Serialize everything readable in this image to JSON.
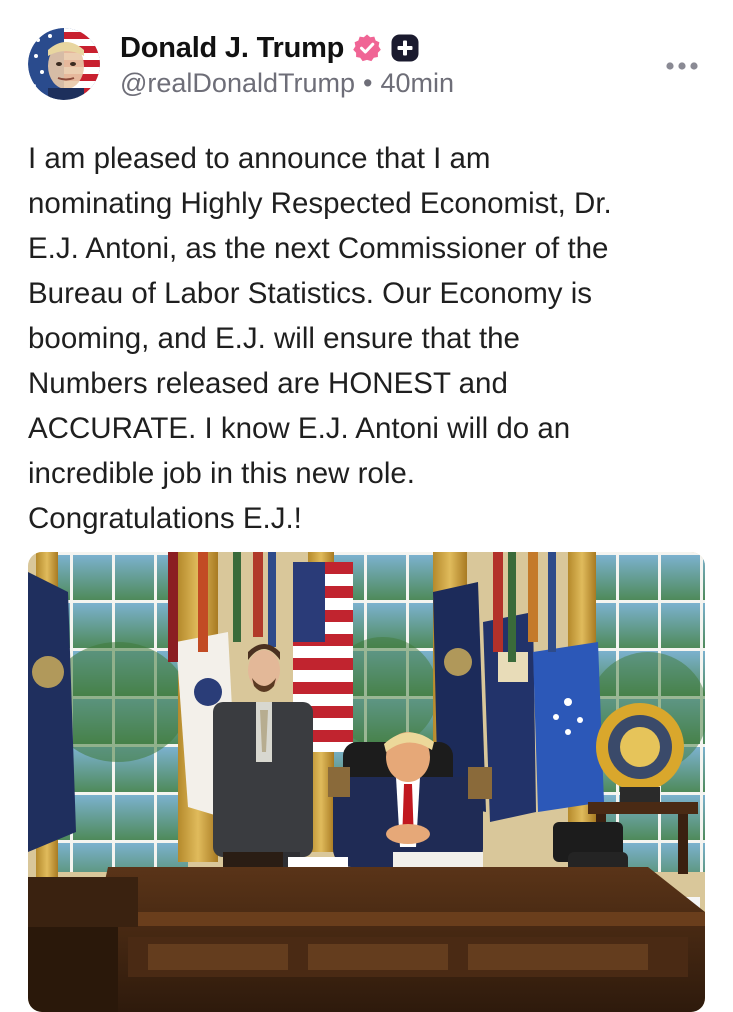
{
  "post": {
    "author": {
      "display_name": "Donald J. Trump",
      "handle": "@realDonaldTrump",
      "separator": "•",
      "timestamp": "40min"
    },
    "text_lines": [
      "I am pleased to announce that I am",
      "nominating Highly Respected Economist, Dr.",
      "E.J. Antoni, as the next Commissioner of the",
      "Bureau of Labor Statistics. Our Economy is",
      "booming, and E.J. will ensure that the",
      "Numbers released are HONEST and",
      "ACCURATE. I know E.J. Antoni will do an",
      "incredible job in this new role.",
      "Congratulations E.J.!"
    ],
    "icons": {
      "verified": "verified-badge-icon",
      "plus": "plus-badge-icon",
      "more": "more-options-icon"
    },
    "colors": {
      "verified": "#f06595",
      "plus_badge": "#1a1a2e",
      "handle": "#6e6e78"
    }
  }
}
